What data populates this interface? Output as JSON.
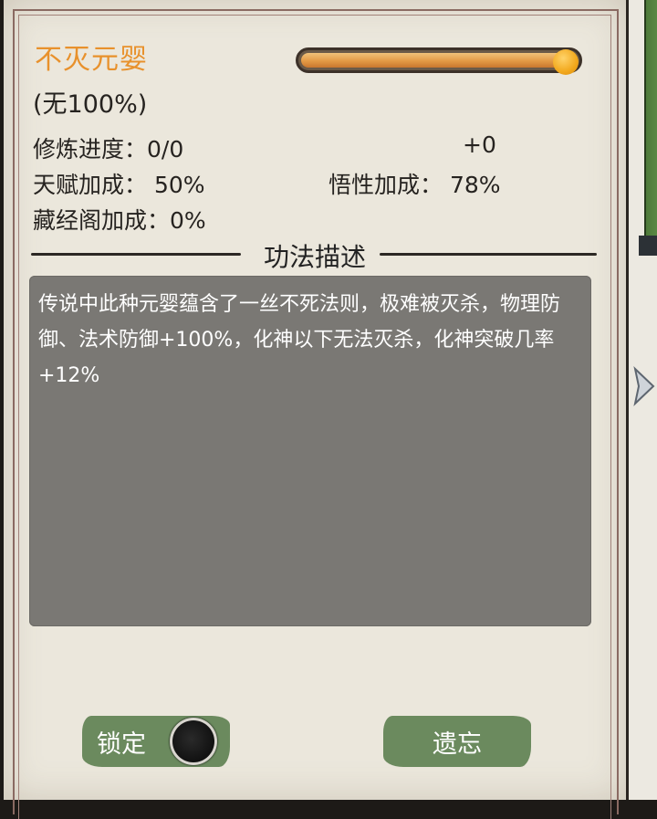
{
  "technique": {
    "name": "不灭元婴",
    "subtitle": "(无100%)",
    "progress_fraction": 0.96
  },
  "stats": {
    "cultivation_progress": "修炼进度：0/0",
    "bonus": "+0",
    "talent_bonus": "天赋加成： 50%",
    "comprehension_bonus": "悟性加成： 78%",
    "library_bonus": "藏经阁加成：0%"
  },
  "description": {
    "heading": "功法描述",
    "text": "传说中此种元婴蕴含了一丝不死法则，极难被灭杀，物理防御、法术防御+100%，化神以下无法灭杀，化神突破几率+12%"
  },
  "buttons": {
    "lock_label": "锁定",
    "forget_label": "遗忘"
  },
  "colors": {
    "title": "#e8912c",
    "button_green": "#6b8a5e",
    "description_bg": "#7a7874",
    "parchment": "#ebe7dc"
  }
}
